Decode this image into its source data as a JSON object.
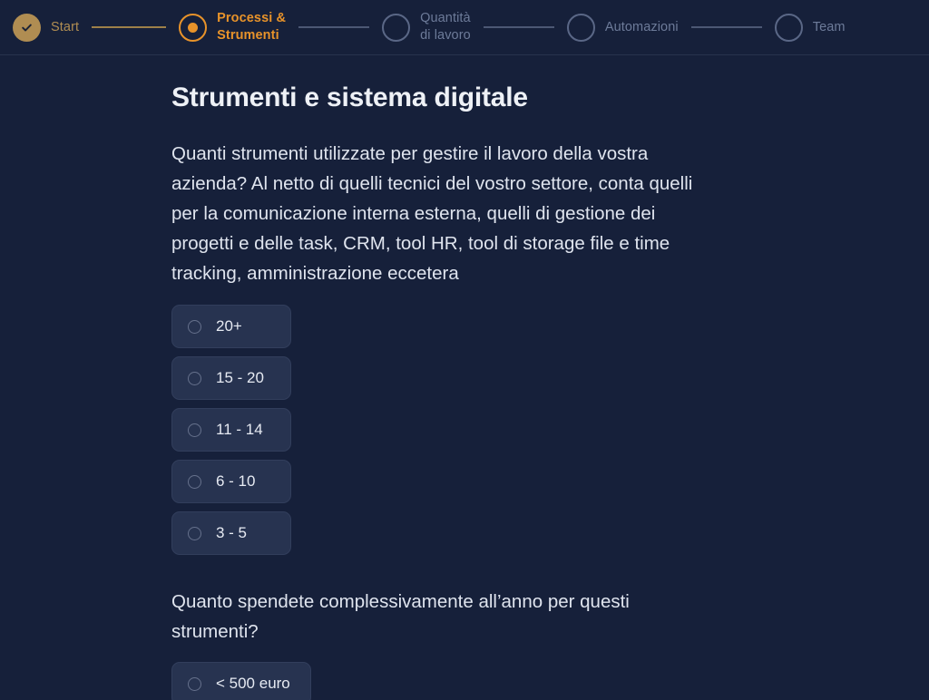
{
  "stepper": {
    "steps": [
      {
        "label": "Start",
        "state": "done",
        "icon": "check-icon"
      },
      {
        "label": "Processi &\nStrumenti",
        "state": "active",
        "icon": "dot-icon"
      },
      {
        "label": "Quantità\ndi lavoro",
        "state": "todo",
        "icon": "circle-icon"
      },
      {
        "label": "Automazioni",
        "state": "todo",
        "icon": "circle-icon"
      },
      {
        "label": "Team",
        "state": "todo",
        "icon": "circle-icon"
      }
    ],
    "connectors": [
      "gold",
      "grey",
      "grey",
      "grey"
    ]
  },
  "page": {
    "title": "Strumenti e sistema digitale"
  },
  "questions": [
    {
      "text": "Quanti strumenti utilizzate per gestire il lavoro della vostra azienda? Al netto di quelli tecnici del vostro settore, conta quelli per la comunicazione interna esterna, quelli di gestione dei progetti e delle task, CRM, tool HR, tool di storage file e time tracking, amministrazione eccetera",
      "options": [
        {
          "label": "20+",
          "selected": false
        },
        {
          "label": "15 - 20",
          "selected": false
        },
        {
          "label": "11 - 14",
          "selected": false
        },
        {
          "label": "6 - 10",
          "selected": false
        },
        {
          "label": "3 - 5",
          "selected": false
        }
      ]
    },
    {
      "text": "Quanto spendete complessivamente all’anno per questi strumenti?",
      "options": [
        {
          "label": "< 500 euro",
          "selected": false
        }
      ]
    }
  ],
  "colors": {
    "background": "#16203a",
    "accent_active": "#e8932a",
    "accent_done": "#b08d52",
    "muted": "#6d7b99",
    "option_background": "#273350",
    "heading": "#eef1f6"
  }
}
